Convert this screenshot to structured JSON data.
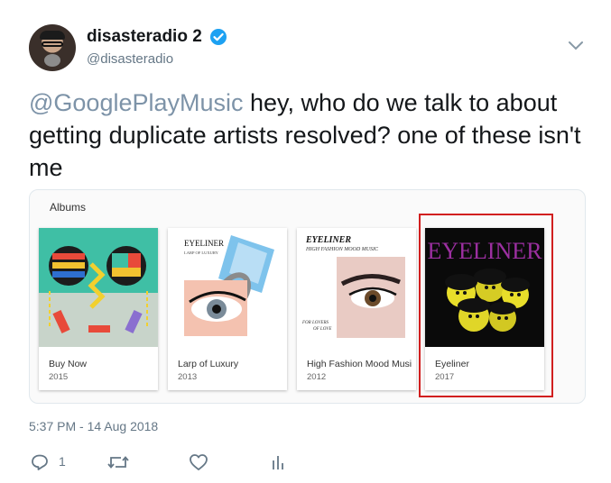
{
  "tweet": {
    "display_name": "disasteradio 2",
    "handle": "@disasteradio",
    "mention": "@GooglePlayMusic",
    "text_after_mention": " hey, who do we talk to about getting duplicate artists resolved? one of these isn't me",
    "timestamp": "5:37 PM - 14 Aug 2018",
    "reply_count": "1"
  },
  "card": {
    "section_title": "Albums",
    "albums": [
      {
        "title": "Buy Now",
        "year": "2015"
      },
      {
        "title": "Larp of Luxury",
        "year": "2013",
        "cover_text": "EYELINER",
        "cover_subtext": "LARP OF LUXURY"
      },
      {
        "title": "High Fashion Mood Music",
        "year": "2012",
        "cover_text": "EYELINER",
        "cover_subtext": "HIGH FASHION MOOD MUSIC",
        "cover_footer_1": "FOR LOVERS",
        "cover_footer_2": "OF LOVE"
      },
      {
        "title": "Eyeliner",
        "year": "2017",
        "cover_text": "EYELINER"
      }
    ]
  },
  "icons": {
    "verified": "verified-badge-icon",
    "caret": "chevron-down-icon",
    "reply": "reply-icon",
    "retweet": "retweet-icon",
    "like": "heart-icon",
    "analytics": "analytics-icon"
  },
  "colors": {
    "verified_blue": "#1da1f2",
    "highlight_red": "#d11f1f",
    "muted_text": "#657786"
  }
}
